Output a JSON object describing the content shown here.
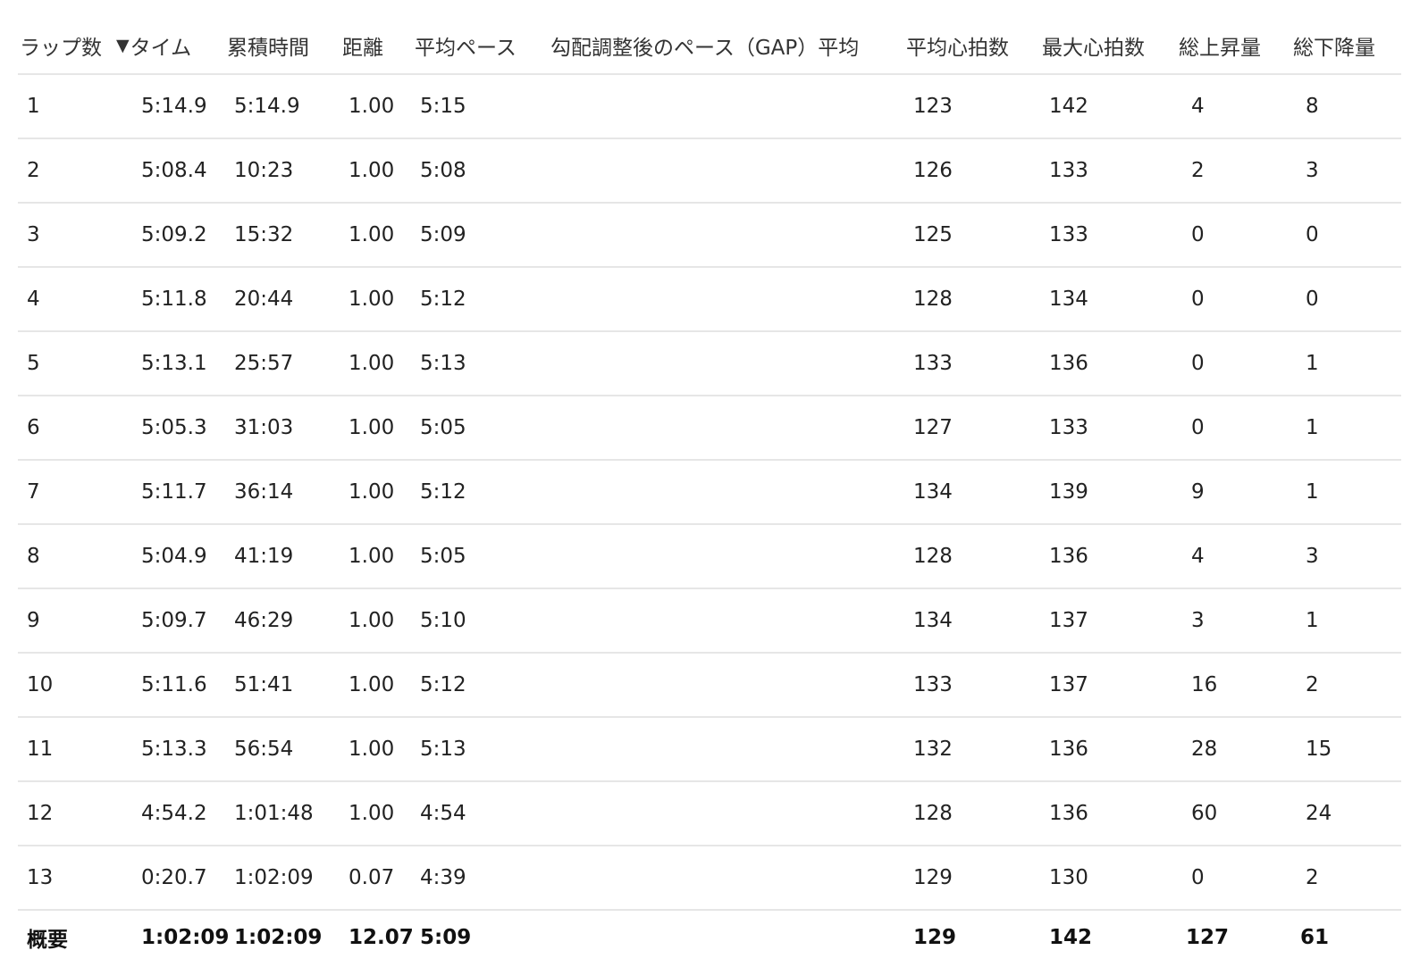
{
  "table": {
    "headers": {
      "lap": "ラップ数",
      "sort_icon": "▼",
      "time": "タイム",
      "cumulative": "累積時間",
      "distance": "距離",
      "avg_pace": "平均ペース",
      "gap": "勾配調整後のペース（GAP）平均",
      "avg_hr": "平均心拍数",
      "max_hr": "最大心拍数",
      "ascent": "総上昇量",
      "descent": "総下降量"
    },
    "rows": [
      {
        "lap": "1",
        "time": "5:14.9",
        "cumulative": "5:14.9",
        "distance": "1.00",
        "avg_pace": "5:15",
        "gap": "",
        "avg_hr": "123",
        "max_hr": "142",
        "ascent": "4",
        "descent": "8"
      },
      {
        "lap": "2",
        "time": "5:08.4",
        "cumulative": "10:23",
        "distance": "1.00",
        "avg_pace": "5:08",
        "gap": "",
        "avg_hr": "126",
        "max_hr": "133",
        "ascent": "2",
        "descent": "3"
      },
      {
        "lap": "3",
        "time": "5:09.2",
        "cumulative": "15:32",
        "distance": "1.00",
        "avg_pace": "5:09",
        "gap": "",
        "avg_hr": "125",
        "max_hr": "133",
        "ascent": "0",
        "descent": "0"
      },
      {
        "lap": "4",
        "time": "5:11.8",
        "cumulative": "20:44",
        "distance": "1.00",
        "avg_pace": "5:12",
        "gap": "",
        "avg_hr": "128",
        "max_hr": "134",
        "ascent": "0",
        "descent": "0"
      },
      {
        "lap": "5",
        "time": "5:13.1",
        "cumulative": "25:57",
        "distance": "1.00",
        "avg_pace": "5:13",
        "gap": "",
        "avg_hr": "133",
        "max_hr": "136",
        "ascent": "0",
        "descent": "1"
      },
      {
        "lap": "6",
        "time": "5:05.3",
        "cumulative": "31:03",
        "distance": "1.00",
        "avg_pace": "5:05",
        "gap": "",
        "avg_hr": "127",
        "max_hr": "133",
        "ascent": "0",
        "descent": "1"
      },
      {
        "lap": "7",
        "time": "5:11.7",
        "cumulative": "36:14",
        "distance": "1.00",
        "avg_pace": "5:12",
        "gap": "",
        "avg_hr": "134",
        "max_hr": "139",
        "ascent": "9",
        "descent": "1"
      },
      {
        "lap": "8",
        "time": "5:04.9",
        "cumulative": "41:19",
        "distance": "1.00",
        "avg_pace": "5:05",
        "gap": "",
        "avg_hr": "128",
        "max_hr": "136",
        "ascent": "4",
        "descent": "3"
      },
      {
        "lap": "9",
        "time": "5:09.7",
        "cumulative": "46:29",
        "distance": "1.00",
        "avg_pace": "5:10",
        "gap": "",
        "avg_hr": "134",
        "max_hr": "137",
        "ascent": "3",
        "descent": "1"
      },
      {
        "lap": "10",
        "time": "5:11.6",
        "cumulative": "51:41",
        "distance": "1.00",
        "avg_pace": "5:12",
        "gap": "",
        "avg_hr": "133",
        "max_hr": "137",
        "ascent": "16",
        "descent": "2"
      },
      {
        "lap": "11",
        "time": "5:13.3",
        "cumulative": "56:54",
        "distance": "1.00",
        "avg_pace": "5:13",
        "gap": "",
        "avg_hr": "132",
        "max_hr": "136",
        "ascent": "28",
        "descent": "15"
      },
      {
        "lap": "12",
        "time": "4:54.2",
        "cumulative": "1:01:48",
        "distance": "1.00",
        "avg_pace": "4:54",
        "gap": "",
        "avg_hr": "128",
        "max_hr": "136",
        "ascent": "60",
        "descent": "24"
      },
      {
        "lap": "13",
        "time": "0:20.7",
        "cumulative": "1:02:09",
        "distance": "0.07",
        "avg_pace": "4:39",
        "gap": "",
        "avg_hr": "129",
        "max_hr": "130",
        "ascent": "0",
        "descent": "2"
      }
    ],
    "summary": {
      "lap": "概要",
      "time": "1:02:09",
      "cumulative": "1:02:09",
      "distance": "12.07",
      "avg_pace": "5:09",
      "gap": "",
      "avg_hr": "129",
      "max_hr": "142",
      "ascent": "127",
      "descent": "61"
    }
  }
}
